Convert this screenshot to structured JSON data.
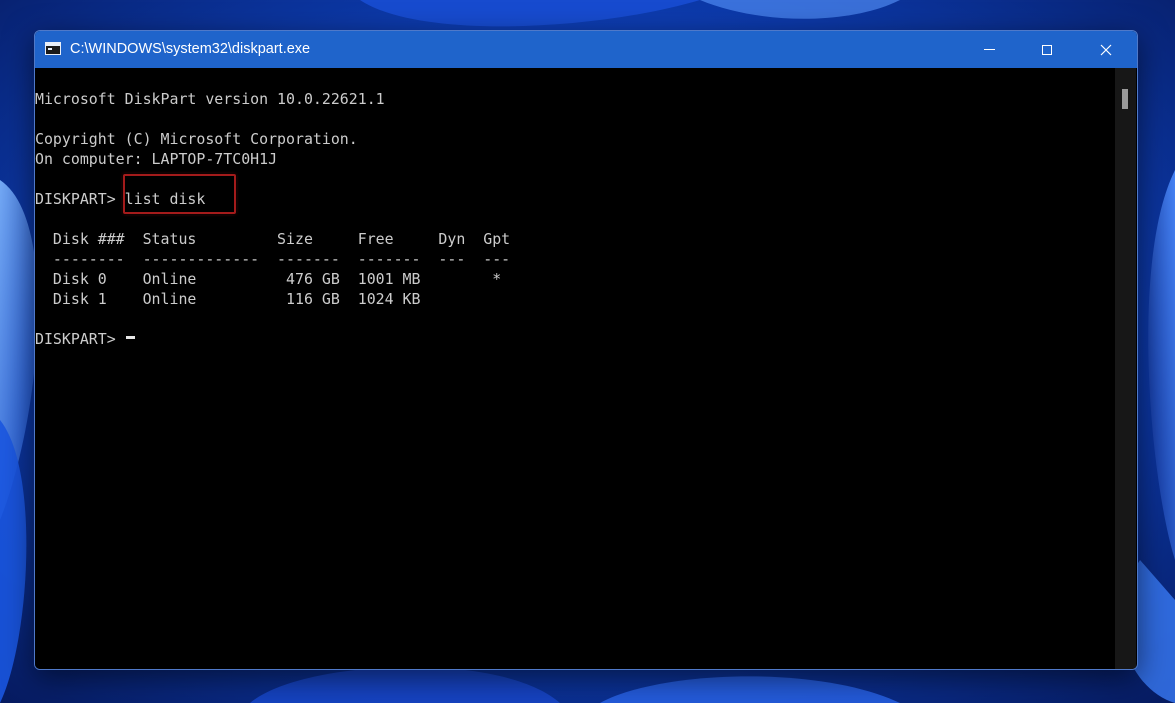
{
  "window": {
    "title": "C:\\WINDOWS\\system32\\diskpart.exe",
    "controls": {
      "minimize": "minimize",
      "maximize": "maximize",
      "close": "close"
    }
  },
  "console": {
    "lines": [
      "Microsoft DiskPart version 10.0.22621.1",
      "Copyright (C) Microsoft Corporation.",
      "On computer: LAPTOP-7TC0H1J",
      "DISKPART> list disk",
      "  Disk ###  Status         Size     Free     Dyn  Gpt",
      "  --------  -------------  -------  -------  ---  ---",
      "  Disk 0    Online          476 GB  1001 MB        *",
      "  Disk 1    Online          116 GB  1024 KB",
      "DISKPART> "
    ]
  },
  "colors": {
    "titlebar": "#1f64cb",
    "console_bg": "#000000",
    "console_text": "#cccccc",
    "highlight": "#a41b1b"
  },
  "icons": {
    "app": "console-app-icon",
    "minimize": "minimize-icon",
    "maximize": "maximize-icon",
    "close": "close-icon"
  }
}
